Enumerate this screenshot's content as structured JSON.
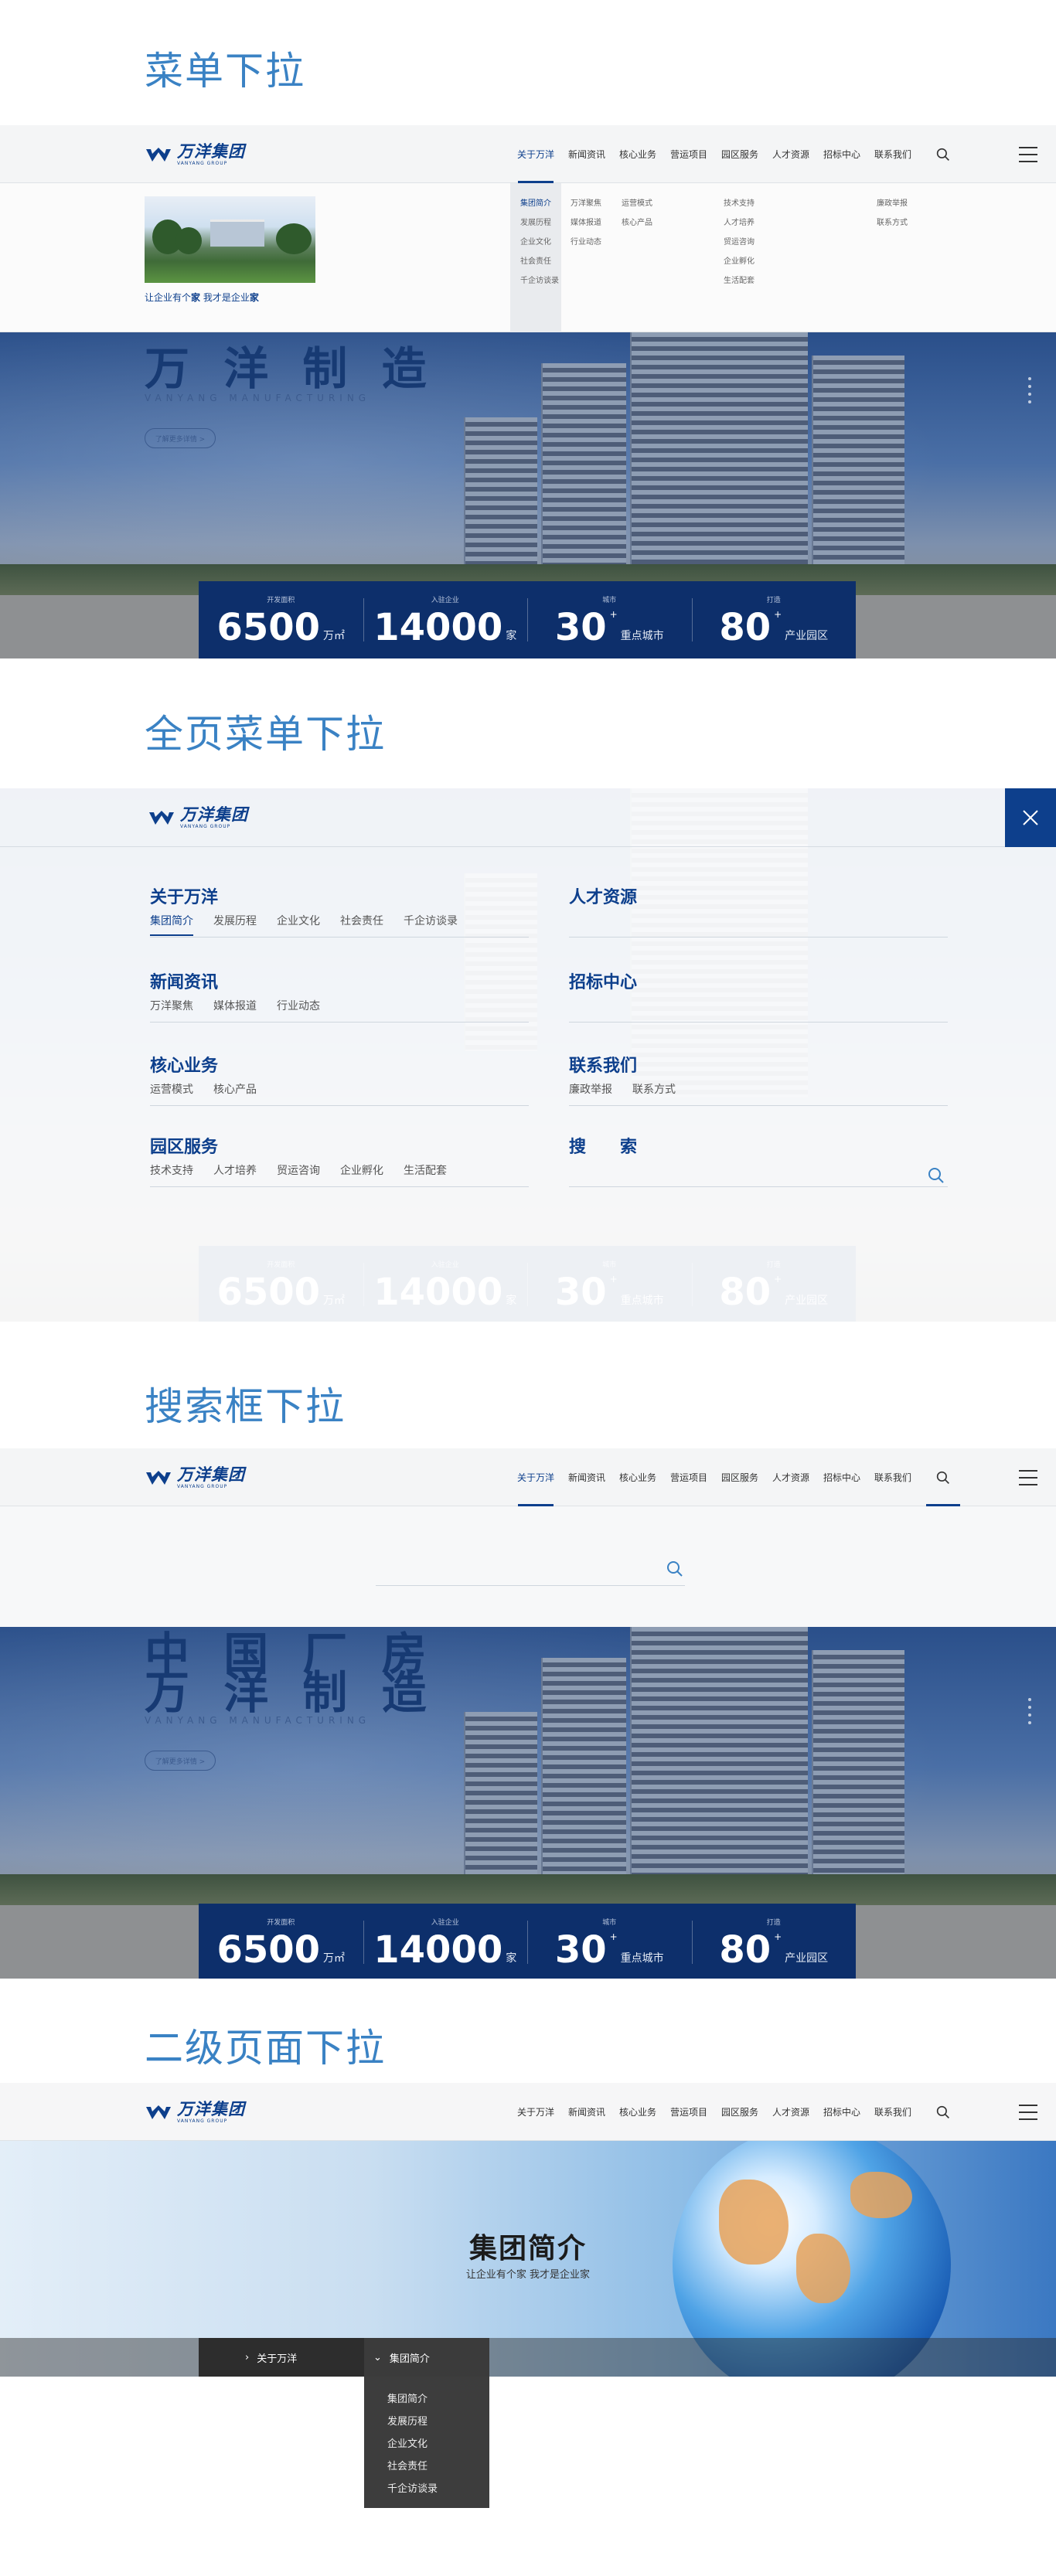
{
  "sections": {
    "s1": "菜单下拉",
    "s2": "全页菜单下拉",
    "s3": "搜索框下拉",
    "s4": "二级页面下拉"
  },
  "logo": {
    "cn": "万洋集团",
    "en": "VANYANG GROUP"
  },
  "nav": [
    {
      "label": "关于万洋"
    },
    {
      "label": "新闻资讯"
    },
    {
      "label": "核心业务"
    },
    {
      "label": "营运项目"
    },
    {
      "label": "园区服务"
    },
    {
      "label": "人才资源"
    },
    {
      "label": "招标中心"
    },
    {
      "label": "联系我们"
    }
  ],
  "dropdown": {
    "slogan_a": "让企业有个",
    "slogan_b": "家",
    "slogan_c": "  我才是企业",
    "slogan_d": "家",
    "about": [
      "集团简介",
      "发展历程",
      "企业文化",
      "社会责任",
      "千企访谈录"
    ],
    "news": [
      "万洋聚焦",
      "媒体报道",
      "行业动态"
    ],
    "core": [
      "运营模式",
      "核心产品"
    ],
    "service": [
      "技术支持",
      "人才培养",
      "贸运咨询",
      "企业孵化",
      "生活配套"
    ],
    "contact": [
      "廉政举报",
      "联系方式"
    ]
  },
  "hero": {
    "title_top": "中 国 厂 房",
    "title": "万 洋 制 造",
    "subtitle": "VANYANG MANUFACTURING",
    "button": "了解更多详情 >",
    "stats": [
      {
        "label": "开发面积",
        "num": "6500",
        "unit": "万㎡",
        "plus": ""
      },
      {
        "label": "入驻企业",
        "num": "14000",
        "unit": "家",
        "plus": ""
      },
      {
        "label": "城市",
        "num": "30",
        "unit": "重点城市",
        "plus": "+"
      },
      {
        "label": "打造",
        "num": "80",
        "unit": "产业园区",
        "plus": "+"
      }
    ]
  },
  "fullmenu": {
    "groups": [
      {
        "title": "关于万洋",
        "links": [
          "集团简介",
          "发展历程",
          "企业文化",
          "社会责任",
          "千企访谈录"
        ]
      },
      {
        "title": "人才资源",
        "links": []
      },
      {
        "title": "新闻资讯",
        "links": [
          "万洋聚焦",
          "媒体报道",
          "行业动态"
        ]
      },
      {
        "title": "招标中心",
        "links": []
      },
      {
        "title": "核心业务",
        "links": [
          "运营模式",
          "核心产品"
        ]
      },
      {
        "title": "联系我们",
        "links": [
          "廉政举报",
          "联系方式"
        ]
      },
      {
        "title": "园区服务",
        "links": [
          "技术支持",
          "人才培养",
          "贸运咨询",
          "企业孵化",
          "生活配套"
        ]
      },
      {
        "title": "搜　　索",
        "links": []
      }
    ]
  },
  "page2": {
    "title": "集团简介",
    "subtitle": "让企业有个家  我才是企业家",
    "crumb1": "关于万洋",
    "crumb2": "集团简介",
    "submenu": [
      "集团简介",
      "发展历程",
      "企业文化",
      "社会责任",
      "千企访谈录"
    ]
  },
  "colors": {
    "brand": "#0d3f8c",
    "title": "#3a82c4"
  }
}
